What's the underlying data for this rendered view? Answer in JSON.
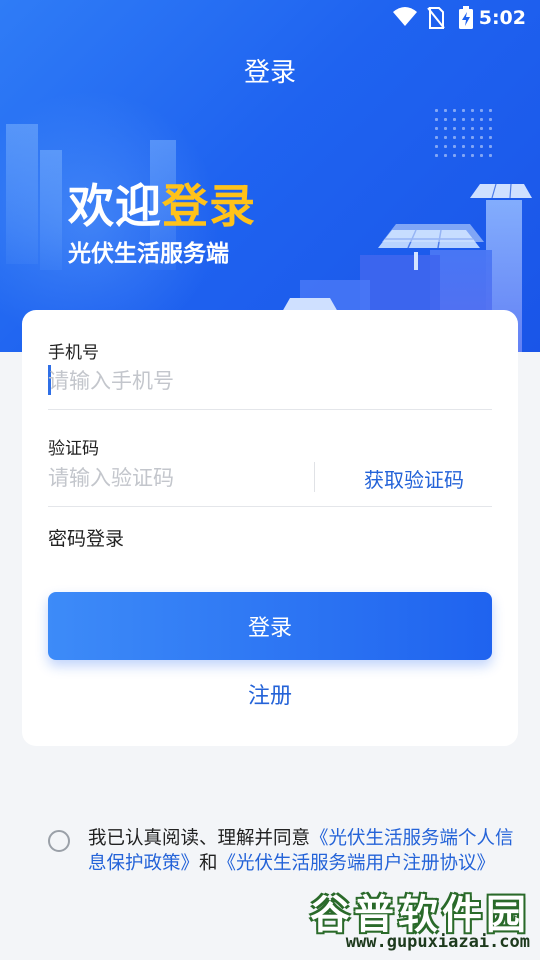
{
  "status_bar": {
    "time": "5:02"
  },
  "header": {
    "title": "登录"
  },
  "hero": {
    "welcome_prefix": "欢迎",
    "welcome_highlight": "登录",
    "subtitle": "光伏生活服务端"
  },
  "form": {
    "phone": {
      "label": "手机号",
      "placeholder": "请输入手机号",
      "value": ""
    },
    "code": {
      "label": "验证码",
      "placeholder": "请输入验证码",
      "value": "",
      "get_code_label": "获取验证码"
    },
    "password_login_label": "密码登录",
    "login_button": "登录",
    "register_link": "注册"
  },
  "agreement": {
    "prefix": "我已认真阅读、理解并同意",
    "link1": "《光伏生活服务端个人信息保护政策》",
    "conjunction": "和",
    "link2": "《光伏生活服务端用户注册协议》",
    "checked": false
  },
  "watermark": {
    "main": "谷普软件园",
    "url": "www.gupuxiazai.com"
  },
  "colors": {
    "primary": "#1f63ef",
    "highlight": "#ffc21a",
    "link": "#2463d8"
  }
}
